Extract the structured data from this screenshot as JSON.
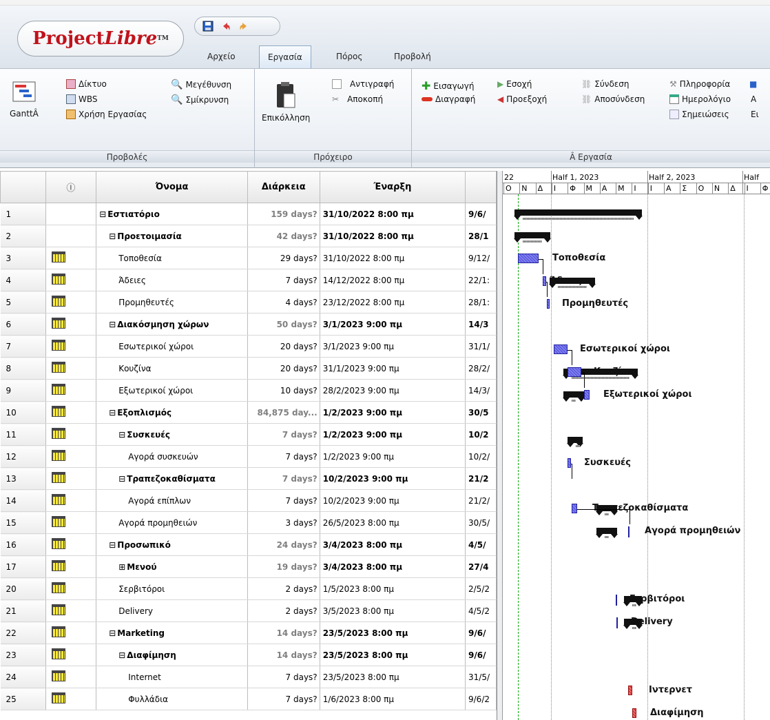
{
  "app": {
    "logo_main": "Project",
    "logo_italic": "Libre",
    "logo_tm": "TM"
  },
  "tabs": [
    "Αρχείο",
    "Εργασία",
    "Πόρος",
    "Προβολή"
  ],
  "active_tab": "Εργασία",
  "ribbon": {
    "groups": {
      "views": "Προβολές",
      "clipboard": "Πρόχειρο",
      "task": "Â Εργασία"
    },
    "gantt_label": "GanttÂ",
    "network": "Δίκτυο",
    "wbs": "WBS",
    "task_usage": "Χρήση Εργασίας",
    "zoom_in": "Μεγέθυνση",
    "zoom_out": "Σμίκρυνση",
    "paste": "Επικόλληση",
    "copy": "Αντιγραφή",
    "cut": "Αποκοπή",
    "insert": "Εισαγωγή",
    "delete": "Διαγραφή",
    "indent": "Εσοχή",
    "outdent": "Προεξοχή",
    "link": "Σύνδεση",
    "unlink": "Αποσύνδεση",
    "info": "Πληροφορία",
    "calendar": "Ημερολόγιο",
    "notes": "Σημειώσεις",
    "extra1": "Α",
    "extra2": "Ει"
  },
  "columns": {
    "num": "",
    "ind": "Ⓘ",
    "name": "Όνομα",
    "dur": "Διάρκεια",
    "start": "Έναρξη",
    "finish": ""
  },
  "rows": [
    {
      "id": "1",
      "icon": false,
      "indent": 0,
      "sum": true,
      "expand": "⊟",
      "name": "Εστιατόριο",
      "dur": "159 days?",
      "start": "31/10/2022 8:00 πμ",
      "finish": "9/6/"
    },
    {
      "id": "2",
      "icon": false,
      "indent": 1,
      "sum": true,
      "expand": "⊟",
      "name": "Προετοιμασία",
      "dur": "42 days?",
      "start": "31/10/2022 8:00 πμ",
      "finish": "28/1"
    },
    {
      "id": "3",
      "icon": true,
      "indent": 2,
      "sum": false,
      "expand": "",
      "name": "Τοποθεσία",
      "dur": "29 days?",
      "start": "31/10/2022 8:00 πμ",
      "finish": "9/12/"
    },
    {
      "id": "4",
      "icon": true,
      "indent": 2,
      "sum": false,
      "expand": "",
      "name": "Άδειες",
      "dur": "7 days?",
      "start": "14/12/2022 8:00 πμ",
      "finish": "22/1:"
    },
    {
      "id": "5",
      "icon": true,
      "indent": 2,
      "sum": false,
      "expand": "",
      "name": "Προμηθευτές",
      "dur": "4 days?",
      "start": "23/12/2022 8:00 πμ",
      "finish": "28/1:"
    },
    {
      "id": "6",
      "icon": true,
      "indent": 1,
      "sum": true,
      "expand": "⊟",
      "name": "Διακόσμηση χώρων",
      "dur": "50 days?",
      "start": "3/1/2023 9:00 πμ",
      "finish": "14/3"
    },
    {
      "id": "7",
      "icon": true,
      "indent": 2,
      "sum": false,
      "expand": "",
      "name": "Εσωτερικοί χώροι",
      "dur": "20 days?",
      "start": "3/1/2023 9:00 πμ",
      "finish": "31/1/"
    },
    {
      "id": "8",
      "icon": true,
      "indent": 2,
      "sum": false,
      "expand": "",
      "name": "Κουζίνα",
      "dur": "20 days?",
      "start": "31/1/2023 9:00 πμ",
      "finish": "28/2/"
    },
    {
      "id": "9",
      "icon": true,
      "indent": 2,
      "sum": false,
      "expand": "",
      "name": "Εξωτερικοί χώροι",
      "dur": "10 days?",
      "start": "28/2/2023 9:00 πμ",
      "finish": "14/3/"
    },
    {
      "id": "10",
      "icon": true,
      "indent": 1,
      "sum": true,
      "expand": "⊟",
      "name": "Εξοπλισμός",
      "dur": "84,875 day...",
      "start": "1/2/2023 9:00 πμ",
      "finish": "30/5"
    },
    {
      "id": "11",
      "icon": true,
      "indent": 2,
      "sum": true,
      "expand": "⊟",
      "name": "Συσκευές",
      "dur": "7 days?",
      "start": "1/2/2023 9:00 πμ",
      "finish": "10/2"
    },
    {
      "id": "12",
      "icon": true,
      "indent": 3,
      "sum": false,
      "expand": "",
      "name": "Αγορά συσκευών",
      "dur": "7 days?",
      "start": "1/2/2023 9:00 πμ",
      "finish": "10/2/"
    },
    {
      "id": "13",
      "icon": true,
      "indent": 2,
      "sum": true,
      "expand": "⊟",
      "name": "Τραπεζοκαθίσματα",
      "dur": "7 days?",
      "start": "10/2/2023 9:00 πμ",
      "finish": "21/2"
    },
    {
      "id": "14",
      "icon": true,
      "indent": 3,
      "sum": false,
      "expand": "",
      "name": "Αγορά επίπλων",
      "dur": "7 days?",
      "start": "10/2/2023 9:00 πμ",
      "finish": "21/2/"
    },
    {
      "id": "15",
      "icon": true,
      "indent": 2,
      "sum": false,
      "expand": "",
      "name": "Αγορά προμηθειών",
      "dur": "3 days?",
      "start": "26/5/2023 8:00 πμ",
      "finish": "30/5/"
    },
    {
      "id": "16",
      "icon": true,
      "indent": 1,
      "sum": true,
      "expand": "⊟",
      "name": "Προσωπικό",
      "dur": "24 days?",
      "start": "3/4/2023 8:00 πμ",
      "finish": "4/5/"
    },
    {
      "id": "17",
      "icon": true,
      "indent": 2,
      "sum": true,
      "expand": "⊞",
      "name": "Μενού",
      "dur": "19 days?",
      "start": "3/4/2023 8:00 πμ",
      "finish": "27/4"
    },
    {
      "id": "20",
      "icon": true,
      "indent": 2,
      "sum": false,
      "expand": "",
      "name": "Σερβιτόροι",
      "dur": "2 days?",
      "start": "1/5/2023 8:00 πμ",
      "finish": "2/5/2"
    },
    {
      "id": "21",
      "icon": true,
      "indent": 2,
      "sum": false,
      "expand": "",
      "name": "Delivery",
      "dur": "2 days?",
      "start": "3/5/2023 8:00 πμ",
      "finish": "4/5/2"
    },
    {
      "id": "22",
      "icon": true,
      "indent": 1,
      "sum": true,
      "expand": "⊟",
      "name": "Marketing",
      "dur": "14 days?",
      "start": "23/5/2023 8:00 πμ",
      "finish": "9/6/"
    },
    {
      "id": "23",
      "icon": true,
      "indent": 2,
      "sum": true,
      "expand": "⊟",
      "name": "Διαφίμηση",
      "dur": "14 days?",
      "start": "23/5/2023 8:00 πμ",
      "finish": "9/6/"
    },
    {
      "id": "24",
      "icon": true,
      "indent": 3,
      "sum": false,
      "expand": "",
      "name": "Internet",
      "dur": "7 days?",
      "start": "23/5/2023 8:00 πμ",
      "finish": "31/5/"
    },
    {
      "id": "25",
      "icon": true,
      "indent": 3,
      "sum": false,
      "expand": "",
      "name": "Φυλλάδια",
      "dur": "7 days?",
      "start": "1/6/2023 8:00 πμ",
      "finish": "9/6/2"
    }
  ],
  "timescale": {
    "top": [
      "22",
      "Half 1, 2023",
      "Half 2, 2023",
      "Half"
    ],
    "bottom": [
      "Ο",
      "Ν",
      "Δ",
      "Ι",
      "Φ",
      "Μ",
      "Α",
      "Μ",
      "Ι",
      "Ι",
      "Α",
      "Σ",
      "Ο",
      "Ν",
      "Δ",
      "Ι",
      "Φ"
    ]
  },
  "gantt_labels": {
    "r3": "Τοποθεσία",
    "r4": "Άδειες",
    "r5": "Προμηθευτές",
    "r7": "Εσωτερικοί χώροι",
    "r8": "Κουζίνα",
    "r9": "Εξωτερικοί χώροι",
    "r12": "Συσκευές",
    "r14": "Τραπεζοκαθίσματα",
    "r15": "Αγορά προμηθειών",
    "r20": "Σερβιτόροι",
    "r21": "Delivery",
    "r24": "Ιντερνετ",
    "r25": "Διαφίμηση"
  },
  "colors": {
    "accent": "#c0121b",
    "bar_blue": "#4d4dd6",
    "bar_red": "#e03030"
  }
}
